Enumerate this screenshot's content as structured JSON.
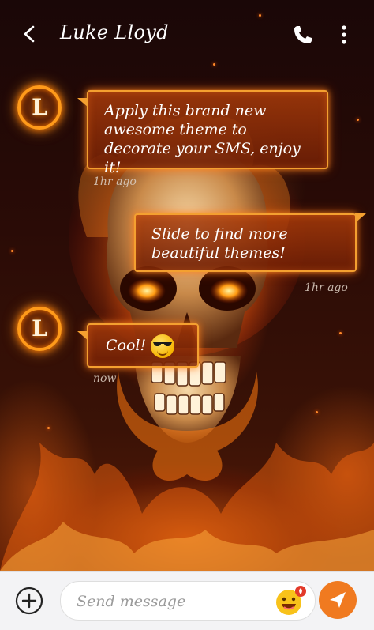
{
  "header": {
    "title": "Luke Lloyd"
  },
  "messages": [
    {
      "direction": "incoming",
      "avatar_letter": "L",
      "text": "Apply this brand new awesome theme to decorate your SMS, enjoy it!",
      "time": "1hr ago"
    },
    {
      "direction": "outgoing",
      "text": "Slide to find more beautiful themes!",
      "time": "1hr ago"
    },
    {
      "direction": "incoming",
      "avatar_letter": "L",
      "text": "Cool!",
      "emoji": "sunglasses-emoji",
      "time": "now"
    }
  ],
  "composer": {
    "placeholder": "Send message"
  },
  "icons": {
    "back": "back-arrow-icon",
    "call": "phone-icon",
    "more": "more-vertical-icon",
    "add": "add-circle-icon",
    "sticker": "emoji-sticker-icon",
    "send": "send-icon"
  },
  "colors": {
    "bubble_border": "#f4a030",
    "send_button": "#f07a20",
    "bottom_bar": "#f3f3f5"
  }
}
